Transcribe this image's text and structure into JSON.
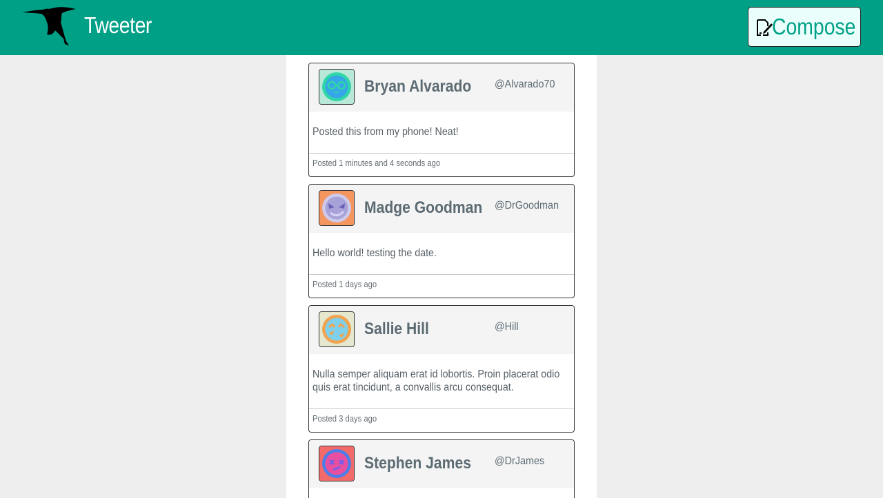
{
  "header": {
    "brand": "Tweeter",
    "compose_label": "Compose",
    "background_color": "#00a087"
  },
  "tweets": [
    {
      "name": "Bryan Alvarado",
      "handle": "@Alvarado70",
      "text": "Posted this from my phone! Neat!",
      "timestamp": "Posted 1 minutes and 4 seconds ago",
      "avatar_icon": "nerd-face-avatar",
      "avatar_colors": {
        "bg": "#b9e8d8",
        "face": "#35a6e8"
      }
    },
    {
      "name": "Madge Goodman",
      "handle": "@DrGoodman",
      "text": "Hello world! testing the date.",
      "timestamp": "Posted 1 days ago",
      "avatar_icon": "smirk-face-avatar",
      "avatar_colors": {
        "bg": "#f5955f",
        "face": "#a7a3d8"
      }
    },
    {
      "name": "Sallie Hill",
      "handle": "@Hill",
      "text": "Nulla semper aliquam erat id lobortis. Proin placerat odio quis erat tincidunt, a convallis arcu consequat.",
      "timestamp": "Posted 3 days ago",
      "avatar_icon": "laughing-face-avatar",
      "avatar_colors": {
        "bg": "#e6e7cf",
        "face": "#7fd0ea"
      }
    },
    {
      "name": "Stephen James",
      "handle": "@DrJames",
      "text": "",
      "timestamp": "",
      "avatar_icon": "dizzy-face-avatar",
      "avatar_colors": {
        "bg": "#f26a6a",
        "face": "#7b5ce8"
      }
    }
  ]
}
